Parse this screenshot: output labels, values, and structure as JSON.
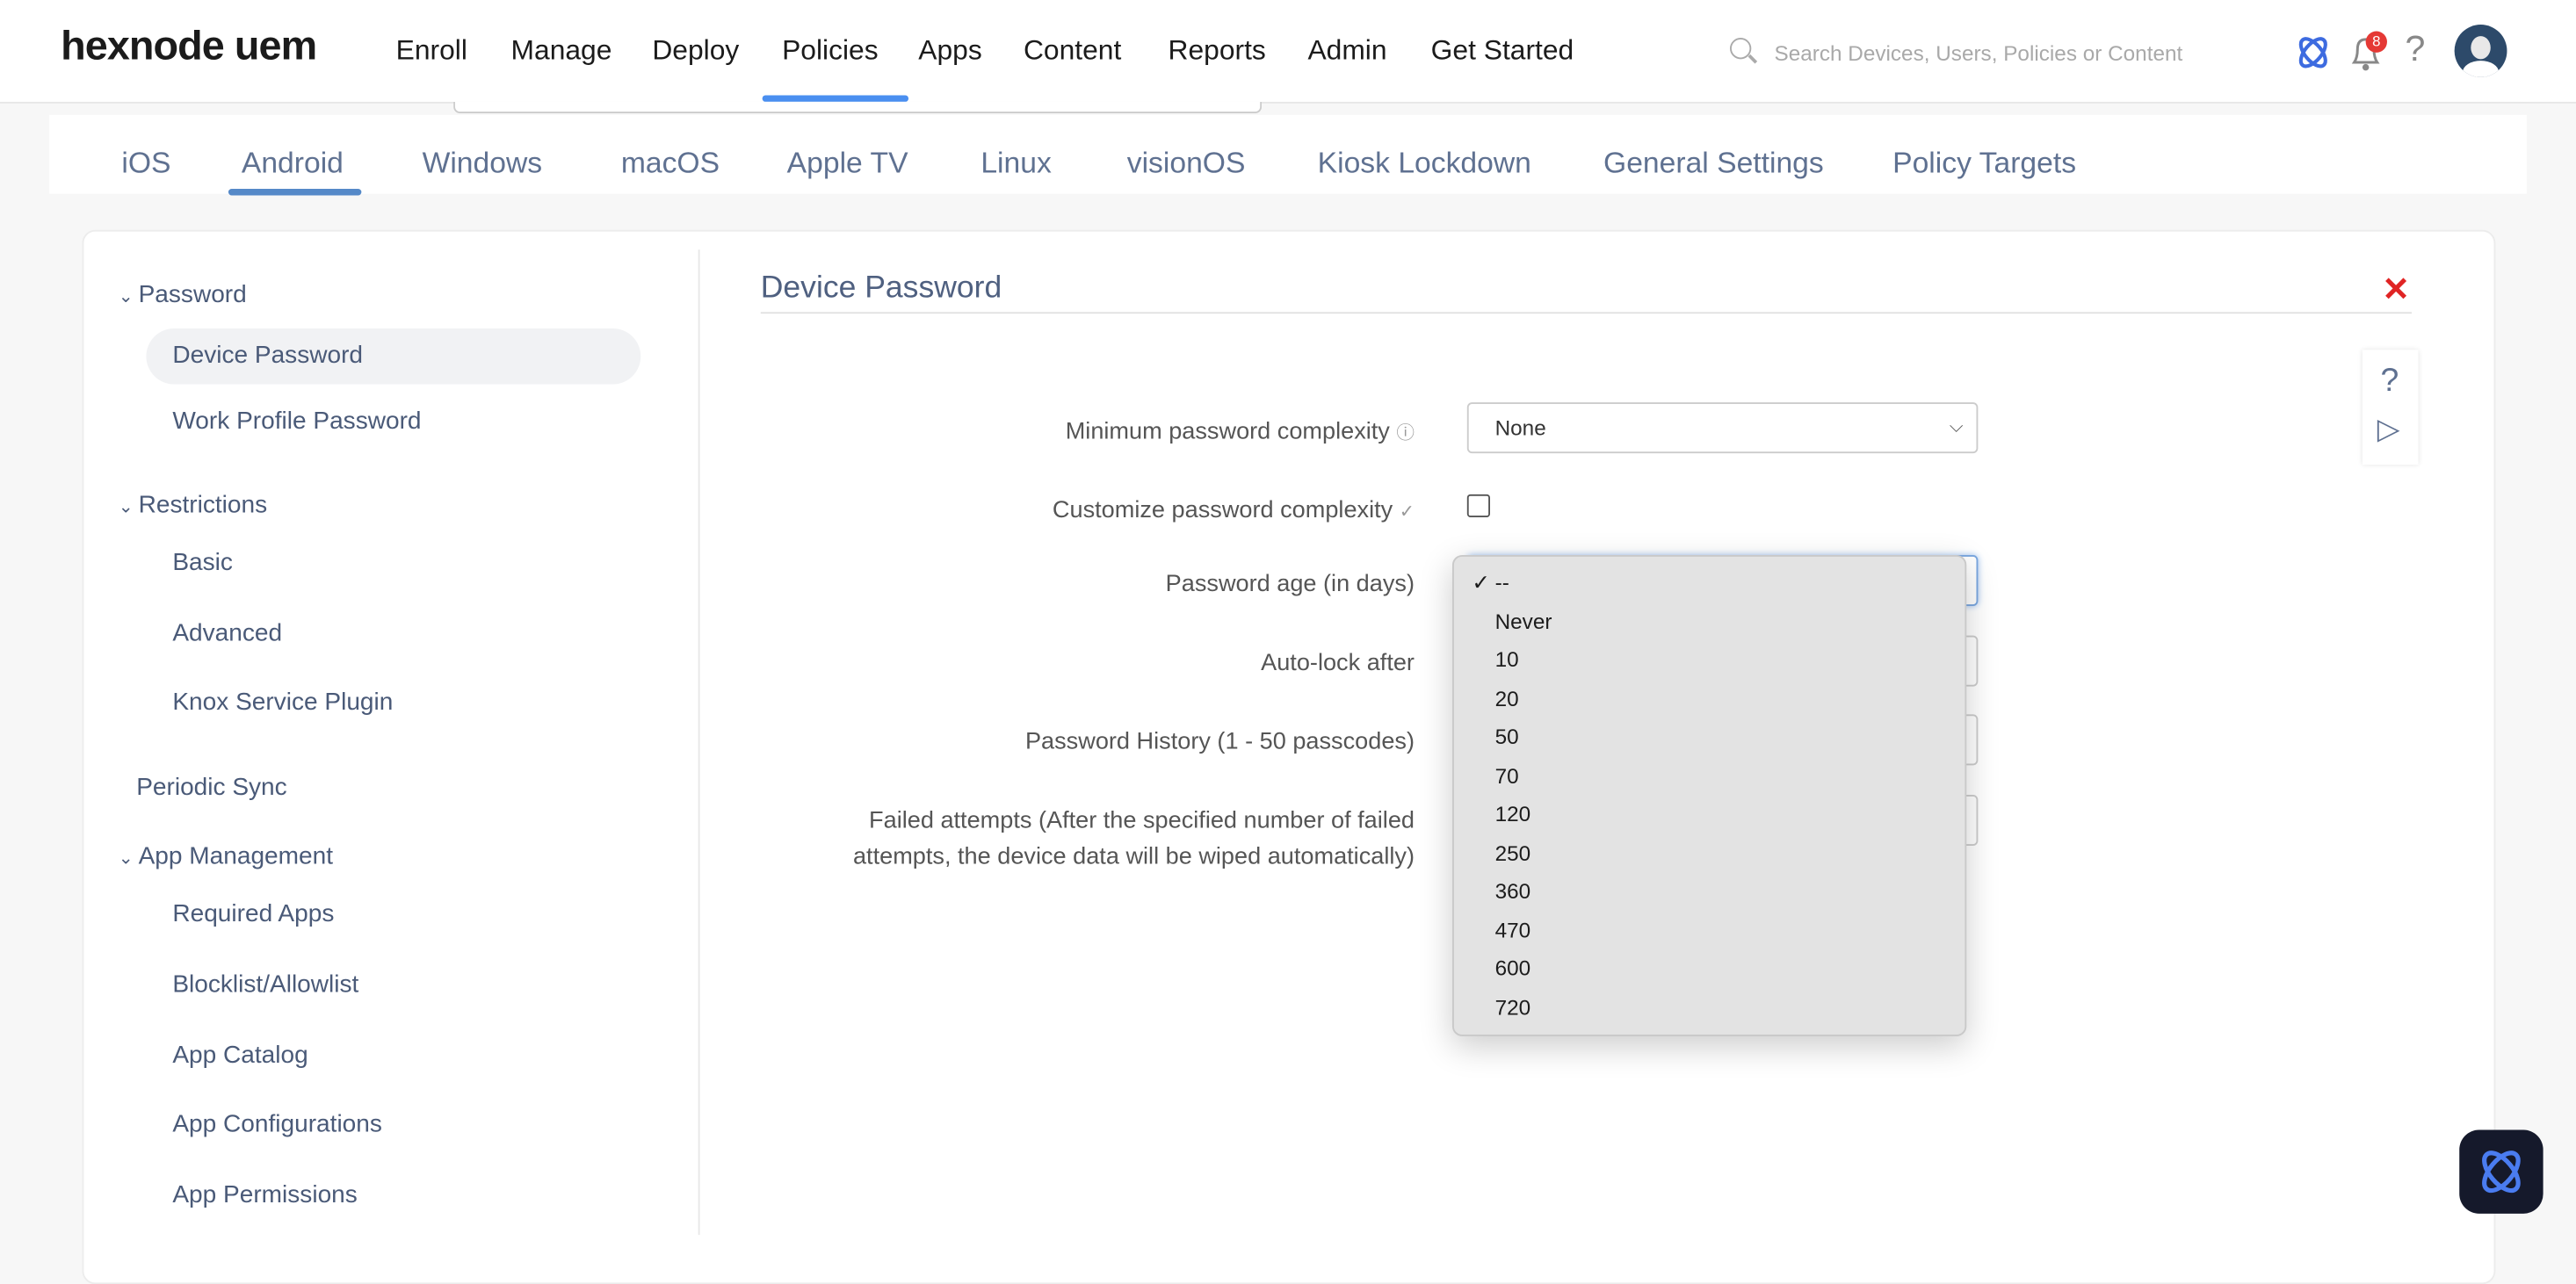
{
  "header": {
    "logo": "hexnode uem",
    "nav": [
      "Enroll",
      "Manage",
      "Deploy",
      "Policies",
      "Apps",
      "Content",
      "Reports",
      "Admin",
      "Get Started"
    ],
    "active_nav": "Policies",
    "search_placeholder": "Search Devices, Users, Policies or Content",
    "notification_count": "8",
    "help": "?",
    "accent_color": "#4a8ff0"
  },
  "tabs": {
    "items": [
      "iOS",
      "Android",
      "Windows",
      "macOS",
      "Apple TV",
      "Linux",
      "visionOS",
      "Kiosk Lockdown",
      "General Settings",
      "Policy Targets"
    ],
    "active": "Android"
  },
  "sidebar": {
    "groups": [
      {
        "label": "Password",
        "items": [
          "Device Password",
          "Work Profile Password"
        ]
      },
      {
        "label": "Restrictions",
        "items": [
          "Basic",
          "Advanced",
          "Knox Service Plugin"
        ]
      },
      {
        "label": "Periodic Sync",
        "items": []
      },
      {
        "label": "App Management",
        "items": [
          "Required Apps",
          "Blocklist/Allowlist",
          "App Catalog",
          "App Configurations",
          "App Permissions"
        ]
      }
    ],
    "selected": "Device Password"
  },
  "main": {
    "title": "Device Password",
    "close": "✕",
    "fields": {
      "min_complexity": {
        "label": "Minimum password complexity",
        "value": "None"
      },
      "customize": {
        "label": "Customize password complexity",
        "checked": false
      },
      "password_age": {
        "label": "Password age (in days)",
        "value": "--"
      },
      "auto_lock": {
        "label": "Auto-lock after"
      },
      "history": {
        "label": "Password History (1 - 50 passcodes)"
      },
      "failed": {
        "label_line1": "Failed attempts (After the specified number of failed",
        "label_line2": "attempts, the device data will be wiped automatically)"
      }
    },
    "dropdown": {
      "selected": "--",
      "options": [
        "--",
        "Never",
        "10",
        "20",
        "50",
        "70",
        "120",
        "250",
        "360",
        "470",
        "600",
        "720"
      ]
    }
  },
  "side_tools": {
    "help": "?",
    "play": "▷"
  }
}
